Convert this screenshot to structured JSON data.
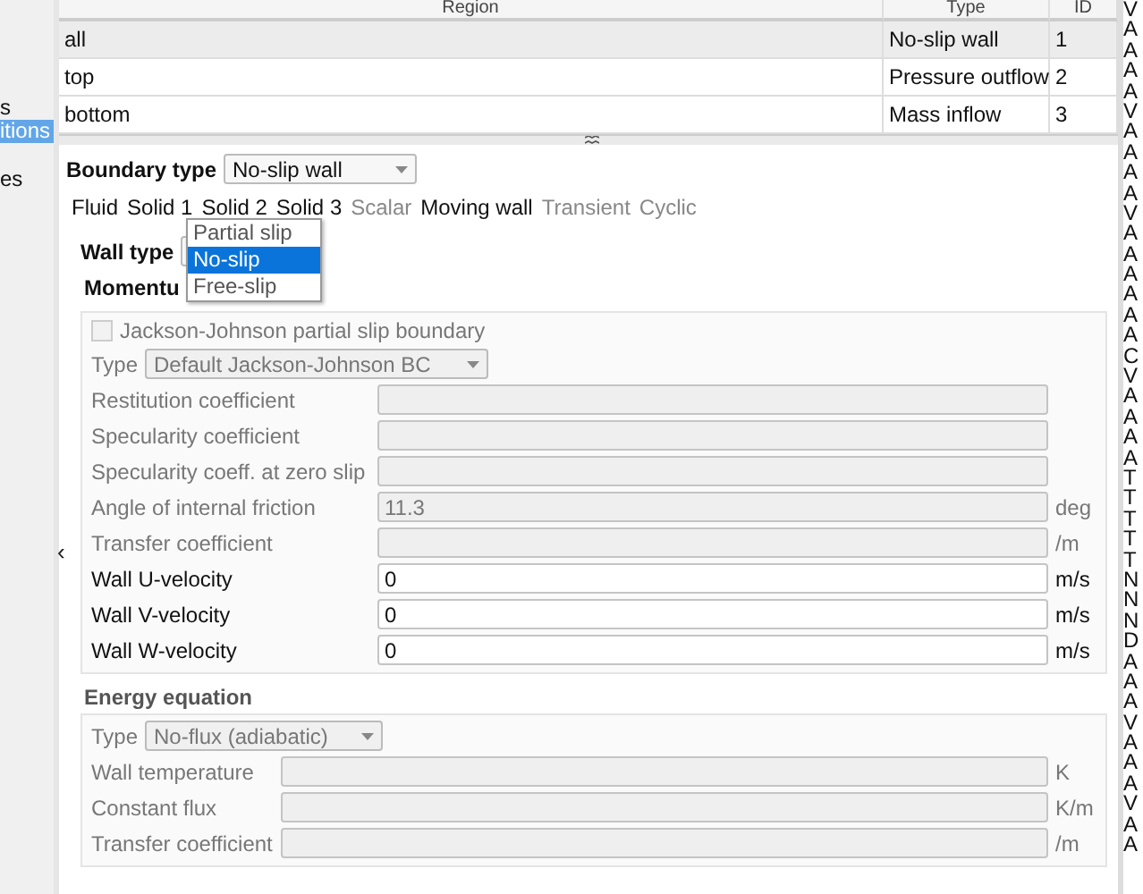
{
  "sidebar": {
    "items": [
      {
        "label": "s",
        "selected": false
      },
      {
        "label": "itions",
        "selected": true
      },
      {
        "label": "es",
        "selected": false
      }
    ],
    "collapse_glyph": "‹"
  },
  "table": {
    "columns": [
      "Region",
      "Type",
      "ID"
    ],
    "rows": [
      {
        "cells": [
          "all",
          "No-slip wall",
          "1"
        ],
        "selected": true
      },
      {
        "cells": [
          "top",
          "Pressure outflow",
          "2"
        ],
        "selected": false
      },
      {
        "cells": [
          "bottom",
          "Mass inflow",
          "3"
        ],
        "selected": false
      }
    ]
  },
  "boundary_type": {
    "label": "Boundary type",
    "value": "No-slip wall"
  },
  "tabs": [
    {
      "label": "Fluid",
      "disabled": false
    },
    {
      "label": "Solid 1",
      "disabled": false
    },
    {
      "label": "Solid 2",
      "disabled": false
    },
    {
      "label": "Solid 3",
      "disabled": false
    },
    {
      "label": "Scalar",
      "disabled": true
    },
    {
      "label": "Moving wall",
      "disabled": false
    },
    {
      "label": "Transient",
      "disabled": true
    },
    {
      "label": "Cyclic",
      "disabled": true
    }
  ],
  "wall_type": {
    "label": "Wall type",
    "options": [
      {
        "label": "Partial slip",
        "selected": false
      },
      {
        "label": "No-slip",
        "selected": true
      },
      {
        "label": "Free-slip",
        "selected": false
      }
    ]
  },
  "momentum": {
    "title": "Momentu",
    "checkbox": {
      "label": "Jackson-Johnson partial slip boundary",
      "checked": false,
      "disabled": true
    },
    "type": {
      "label": "Type",
      "value": "Default Jackson-Johnson BC",
      "disabled": true
    },
    "fields": [
      {
        "label": "Restitution coefficient",
        "disabled": true
      },
      {
        "label": "Specularity coefficient",
        "disabled": true
      },
      {
        "label": "Specularity coeff. at zero slip",
        "disabled": true
      },
      {
        "label": "Angle of internal friction",
        "value": "11.3",
        "unit": "deg",
        "disabled": true
      },
      {
        "label": "Transfer coefficient",
        "unit": "/m",
        "disabled": true
      },
      {
        "label": "Wall U-velocity",
        "value": "0",
        "unit": "m/s",
        "disabled": false
      },
      {
        "label": "Wall V-velocity",
        "value": "0",
        "unit": "m/s",
        "disabled": false
      },
      {
        "label": "Wall W-velocity",
        "value": "0",
        "unit": "m/s",
        "disabled": false
      }
    ]
  },
  "energy": {
    "title": "Energy equation",
    "type": {
      "label": "Type",
      "value": "No-flux (adiabatic)",
      "disabled": true
    },
    "fields": [
      {
        "label": "Wall temperature",
        "unit": "K",
        "disabled": true
      },
      {
        "label": "Constant flux",
        "unit": "K/m",
        "disabled": true
      },
      {
        "label": "Transfer coefficient",
        "unit": "/m",
        "disabled": true
      }
    ]
  },
  "side_list": {
    "items": [
      "V",
      "A",
      "A",
      "A",
      "A",
      "V",
      "A",
      "A",
      "A",
      "A",
      "V",
      "A",
      "A",
      "A",
      "A",
      "A",
      "A",
      "C",
      "V",
      "A",
      "A",
      "A",
      "A",
      "T",
      "T",
      "T",
      "T",
      "T",
      "N",
      "N",
      "N",
      "D",
      "A",
      "A",
      "A",
      "V",
      "A",
      "A",
      "A",
      "V",
      "A",
      "A"
    ]
  }
}
